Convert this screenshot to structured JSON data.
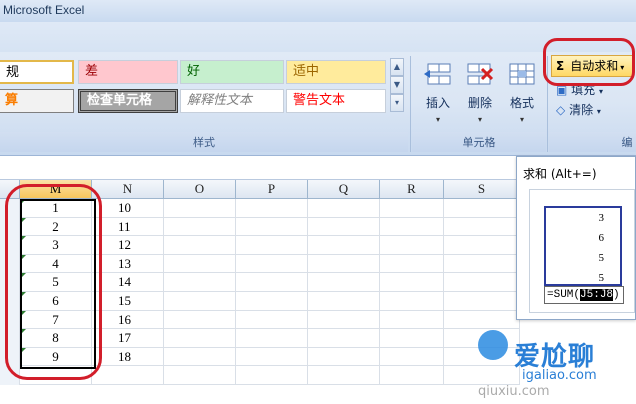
{
  "window": {
    "title": "Microsoft Excel"
  },
  "ribbon": {
    "styles": {
      "row1": [
        "规",
        "差",
        "好",
        "适中"
      ],
      "row2": [
        "算",
        "检查单元格",
        "解释性文本",
        "警告文本"
      ],
      "group_label": "样式"
    },
    "cells_group": {
      "insert_label": "插入",
      "delete_label": "删除",
      "format_label": "格式",
      "group_label": "单元格"
    },
    "editing_group": {
      "autosum_symbol": "Σ",
      "autosum_label": "自动求和",
      "fill_label": "填充",
      "clear_label": "清除",
      "group_label": "编"
    }
  },
  "grid": {
    "columns": [
      "M",
      "N",
      "O",
      "P",
      "Q",
      "R",
      "S"
    ],
    "column_m": [
      "1",
      "2",
      "3",
      "4",
      "5",
      "6",
      "7",
      "8",
      "9"
    ],
    "column_n": [
      "10",
      "11",
      "12",
      "13",
      "14",
      "15",
      "16",
      "17",
      "18"
    ]
  },
  "tooltip": {
    "title": "求和 (Alt+=)",
    "preview_values": [
      "3",
      "6",
      "5",
      "5"
    ],
    "formula_prefix": "=SUM(",
    "formula_ref": "J5:J8",
    "formula_suffix": ")"
  },
  "watermark": {
    "site_cn": "爱尬聊",
    "site_url": "igaliao.com",
    "overlay_text": "qiuxiu.com"
  },
  "colors": {
    "highlight": "#d21e2a",
    "selected_header": "#f8c65c",
    "autosum": "#ffd864"
  }
}
